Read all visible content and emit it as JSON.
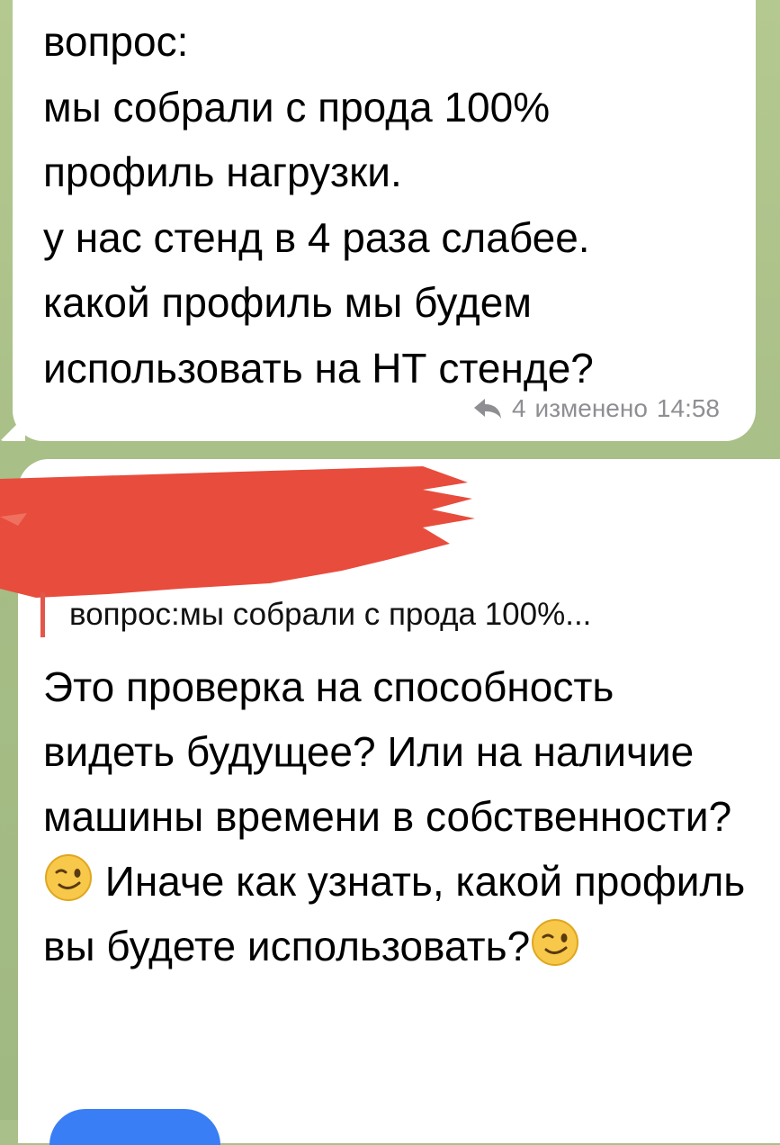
{
  "chat": {
    "message1": {
      "text": "вопрос:\nмы собрали с прода 100%\nпрофиль нагрузки.\nу нас стенд в 4 раза слабее.\nкакой профиль мы будем\nиспользовать на НТ стенде?",
      "reply_count": "4",
      "edited_label": "изменено",
      "time": "14:58"
    },
    "message2": {
      "quote": "вопрос:мы собрали с прода 100%...",
      "part1": "Это проверка на способность видеть будущее? Или на наличие машины времени в собственности?",
      "part2": " Иначе как узнать, какой профиль вы будете использовать?"
    }
  },
  "colors": {
    "redaction": "#e84c3d",
    "quote_bar": "#e2574c",
    "meta_text": "#8e8e93",
    "background": "#a9c08a"
  },
  "icons": [
    "reply-arrow-icon",
    "wink-emoji-icon"
  ]
}
